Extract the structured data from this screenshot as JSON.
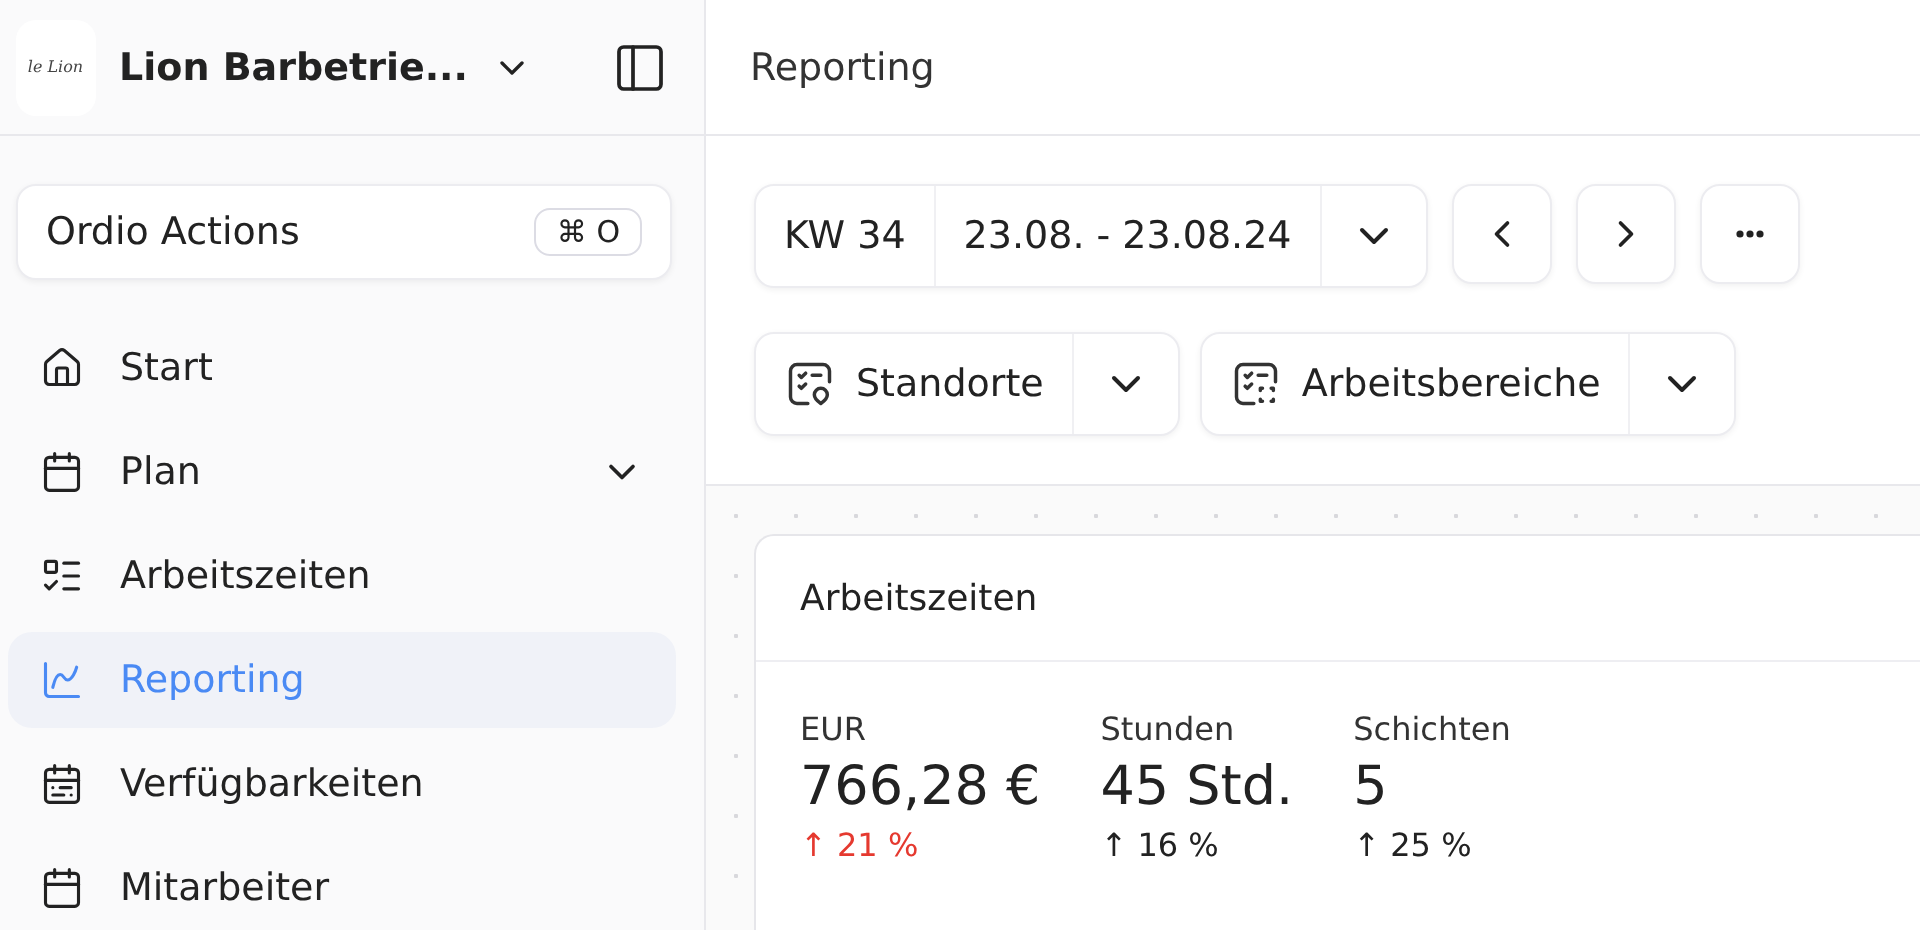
{
  "sidebar": {
    "logo_text": "le Lion",
    "company": "Lion Barbetrie...",
    "actions": {
      "label": "Ordio Actions",
      "shortcut": "⌘ O"
    },
    "items": [
      {
        "label": "Start",
        "selected": false,
        "expandable": false
      },
      {
        "label": "Plan",
        "selected": false,
        "expandable": true
      },
      {
        "label": "Arbeitszeiten",
        "selected": false,
        "expandable": false
      },
      {
        "label": "Reporting",
        "selected": true,
        "expandable": false
      },
      {
        "label": "Verfügbarkeiten",
        "selected": false,
        "expandable": false
      },
      {
        "label": "Mitarbeiter",
        "selected": false,
        "expandable": false
      }
    ]
  },
  "page_title": "Reporting",
  "toolbar": {
    "week": "KW 34",
    "range": "23.08. - 23.08.24",
    "filters": [
      {
        "label": "Standorte"
      },
      {
        "label": "Arbeitsbereiche"
      }
    ]
  },
  "card": {
    "title": "Arbeitszeiten",
    "stats": [
      {
        "label": "EUR",
        "value": "766,28 €",
        "trend": "↑ 21 %",
        "color": "#e5392f"
      },
      {
        "label": "Stunden",
        "value": "45 Std.",
        "trend": "↑ 16 %",
        "color": "#222222"
      },
      {
        "label": "Schichten",
        "value": "5",
        "trend": "↑ 25 %",
        "color": "#222222"
      }
    ]
  }
}
